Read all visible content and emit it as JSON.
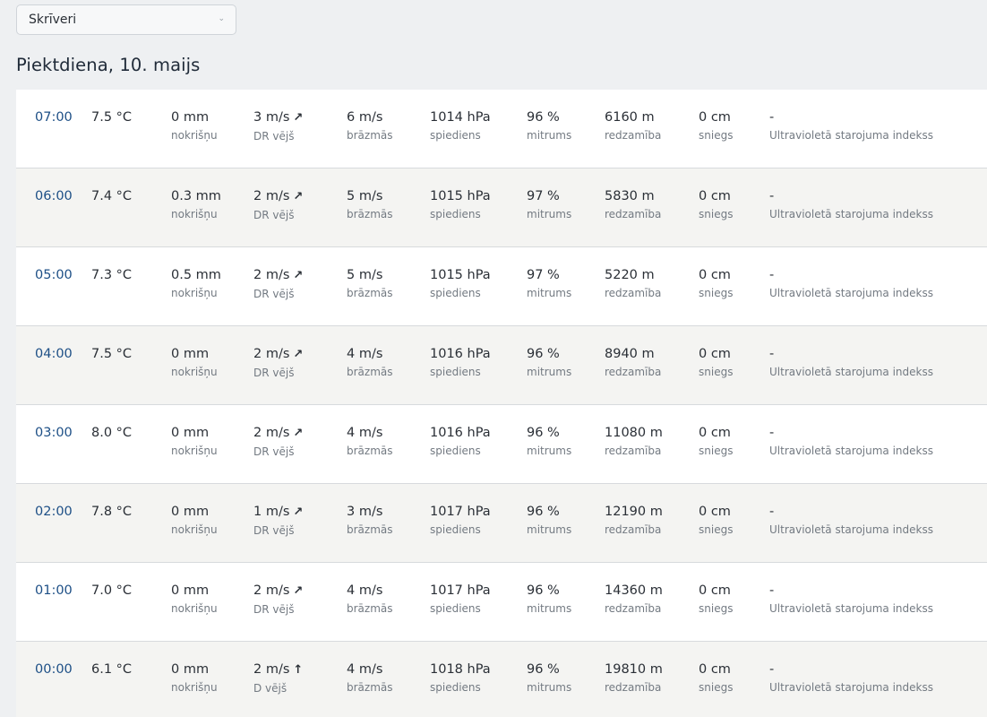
{
  "location": {
    "selected": "Skrīveri"
  },
  "day_title": "Piektdiena, 10. maijs",
  "labels": {
    "precip": "nokrišņu",
    "gust": "brāzmās",
    "pressure": "spiediens",
    "humidity": "mitrums",
    "visibility": "redzamība",
    "snow": "sniegs",
    "uv": "Ultravioletā starojuma indekss"
  },
  "rows": [
    {
      "time": "07:00",
      "temp": "7.5 °C",
      "precip": "0 mm",
      "wind": "3 m/s",
      "wind_arrow": "↗",
      "wind_dir": "DR vējš",
      "gust": "6 m/s",
      "pressure": "1014 hPa",
      "humidity": "96 %",
      "visibility": "6160 m",
      "snow": "0 cm",
      "uv": "-"
    },
    {
      "time": "06:00",
      "temp": "7.4 °C",
      "precip": "0.3 mm",
      "wind": "2 m/s",
      "wind_arrow": "↗",
      "wind_dir": "DR vējš",
      "gust": "5 m/s",
      "pressure": "1015 hPa",
      "humidity": "97 %",
      "visibility": "5830 m",
      "snow": "0 cm",
      "uv": "-"
    },
    {
      "time": "05:00",
      "temp": "7.3 °C",
      "precip": "0.5 mm",
      "wind": "2 m/s",
      "wind_arrow": "↗",
      "wind_dir": "DR vējš",
      "gust": "5 m/s",
      "pressure": "1015 hPa",
      "humidity": "97 %",
      "visibility": "5220 m",
      "snow": "0 cm",
      "uv": "-"
    },
    {
      "time": "04:00",
      "temp": "7.5 °C",
      "precip": "0 mm",
      "wind": "2 m/s",
      "wind_arrow": "↗",
      "wind_dir": "DR vējš",
      "gust": "4 m/s",
      "pressure": "1016 hPa",
      "humidity": "96 %",
      "visibility": "8940 m",
      "snow": "0 cm",
      "uv": "-"
    },
    {
      "time": "03:00",
      "temp": "8.0 °C",
      "precip": "0 mm",
      "wind": "2 m/s",
      "wind_arrow": "↗",
      "wind_dir": "DR vējš",
      "gust": "4 m/s",
      "pressure": "1016 hPa",
      "humidity": "96 %",
      "visibility": "11080 m",
      "snow": "0 cm",
      "uv": "-"
    },
    {
      "time": "02:00",
      "temp": "7.8 °C",
      "precip": "0 mm",
      "wind": "1 m/s",
      "wind_arrow": "↗",
      "wind_dir": "DR vējš",
      "gust": "3 m/s",
      "pressure": "1017 hPa",
      "humidity": "96 %",
      "visibility": "12190 m",
      "snow": "0 cm",
      "uv": "-"
    },
    {
      "time": "01:00",
      "temp": "7.0 °C",
      "precip": "0 mm",
      "wind": "2 m/s",
      "wind_arrow": "↗",
      "wind_dir": "DR vējš",
      "gust": "4 m/s",
      "pressure": "1017 hPa",
      "humidity": "96 %",
      "visibility": "14360 m",
      "snow": "0 cm",
      "uv": "-"
    },
    {
      "time": "00:00",
      "temp": "6.1 °C",
      "precip": "0 mm",
      "wind": "2 m/s",
      "wind_arrow": "↑",
      "wind_dir": "D vējš",
      "gust": "4 m/s",
      "pressure": "1018 hPa",
      "humidity": "96 %",
      "visibility": "19810 m",
      "snow": "0 cm",
      "uv": "-"
    }
  ]
}
